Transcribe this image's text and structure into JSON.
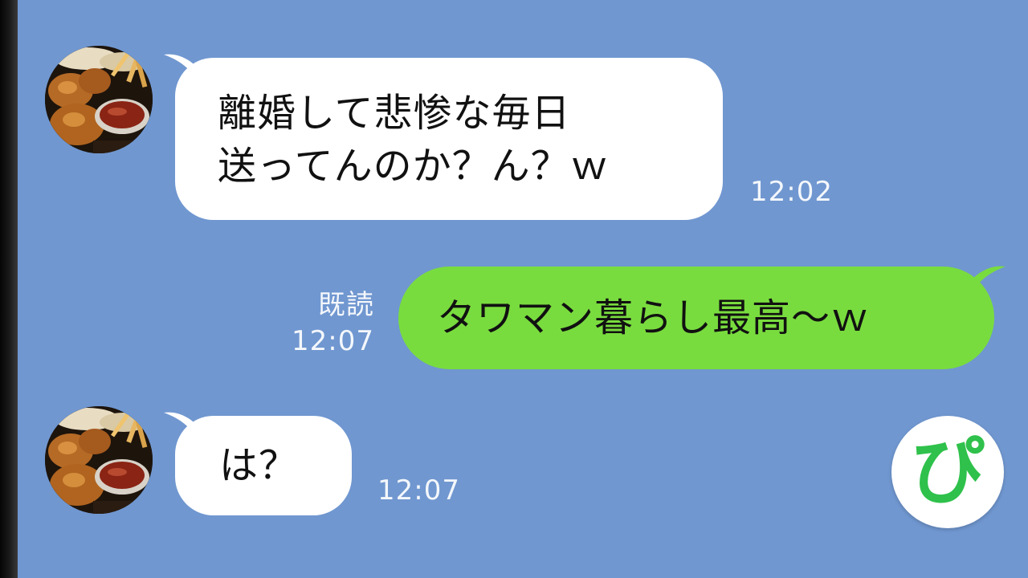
{
  "messages": [
    {
      "direction": "incoming",
      "avatar_icon": "fried-chicken-nuggets-photo",
      "lines": [
        "離婚して悲惨な毎日",
        "送ってんのか？ん？ｗ"
      ],
      "time": "12:02"
    },
    {
      "direction": "outgoing",
      "read_label": "既読",
      "time": "12:07",
      "lines": [
        "タワマン暮らし最高〜ｗ"
      ]
    },
    {
      "direction": "incoming",
      "avatar_icon": "fried-chicken-nuggets-photo",
      "lines": [
        "は？"
      ],
      "time": "12:07"
    }
  ],
  "sticker_button": {
    "icon": "pi-sticker-icon",
    "glyph": "ぴ"
  },
  "colors": {
    "background": "#7097d0",
    "incoming_bubble": "#ffffff",
    "outgoing_bubble": "#79dc3e",
    "meta_text": "#f4f7fb",
    "sticker_glyph": "#2fc14b"
  }
}
